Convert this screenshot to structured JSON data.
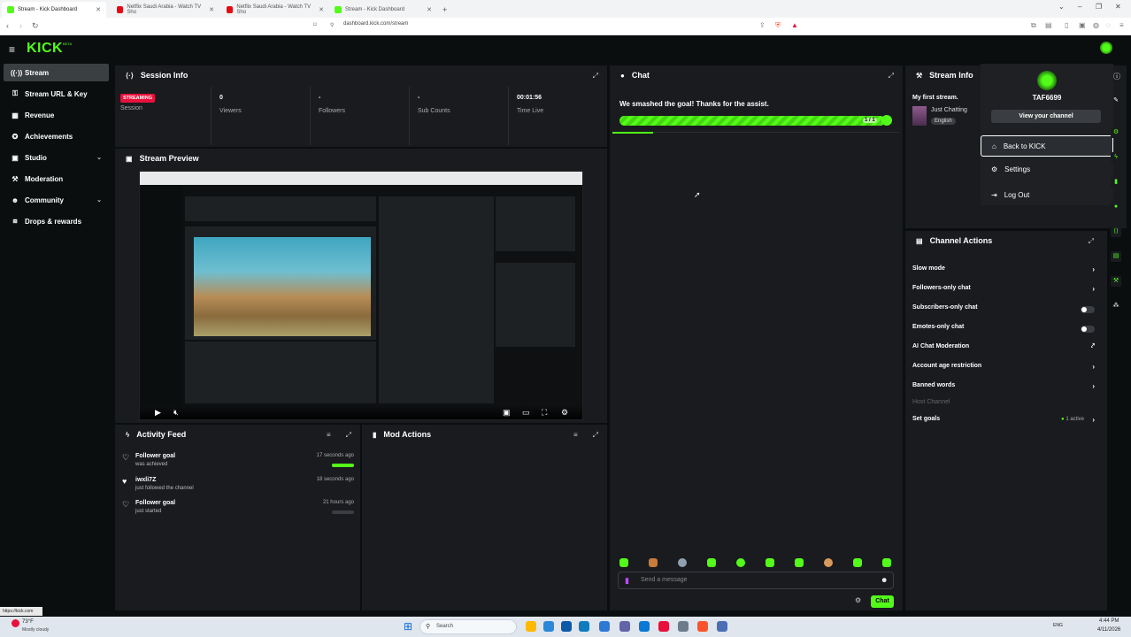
{
  "browser": {
    "tabs": [
      {
        "title": "Stream - Kick Dashboard",
        "active": true
      },
      {
        "title": "Netflix Saudi Arabia - Watch TV Sho",
        "active": false
      },
      {
        "title": "Netflix Saudi Arabia - Watch TV Sho",
        "active": false
      },
      {
        "title": "Stream - Kick Dashboard",
        "active": false
      }
    ],
    "new_tab": "+",
    "url": "dashboard.kick.com/stream"
  },
  "app": {
    "logo": "KICK",
    "logo_badge": "BETA"
  },
  "sidebar": {
    "items": [
      {
        "label": "Stream",
        "icon": "antenna-icon"
      },
      {
        "label": "Stream URL & Key",
        "icon": "key-icon"
      },
      {
        "label": "Revenue",
        "icon": "revenue-icon"
      },
      {
        "label": "Achievements",
        "icon": "trophy-icon"
      },
      {
        "label": "Studio",
        "icon": "studio-icon"
      },
      {
        "label": "Moderation",
        "icon": "wrench-icon"
      },
      {
        "label": "Community",
        "icon": "community-icon"
      },
      {
        "label": "Drops & rewards",
        "icon": "gift-icon"
      }
    ]
  },
  "session": {
    "title": "Session Info",
    "badge": "STREAMING",
    "stats": [
      {
        "value": "",
        "label": "Session"
      },
      {
        "value": "0",
        "label": "Viewers"
      },
      {
        "value": "-",
        "label": "Followers"
      },
      {
        "value": "-",
        "label": "Sub Counts"
      },
      {
        "value": "00:01:56",
        "label": "Time Live"
      }
    ]
  },
  "preview": {
    "title": "Stream Preview"
  },
  "activity": {
    "title": "Activity Feed",
    "items": [
      {
        "title": "Follower goal",
        "sub": "was achieved",
        "time": "17 seconds ago",
        "progress": 1.0
      },
      {
        "title": "iwxli7Z",
        "sub": "just followed the channel",
        "time": "18 seconds ago"
      },
      {
        "title": "Follower goal",
        "sub": "just started",
        "time": "21 hours ago",
        "progress": 0.0
      }
    ]
  },
  "mod": {
    "title": "Mod Actions"
  },
  "chat": {
    "title": "Chat",
    "goal_text": "We smashed the goal! Thanks for the assist.",
    "goal_count": "1 / 1",
    "goal_progress": 1.0,
    "input_placeholder": "Send a message",
    "send_label": "Chat"
  },
  "stream_info": {
    "title": "Stream Info",
    "stream_title": "My first stream.",
    "category": "Just Chatting",
    "language": "English"
  },
  "user_menu": {
    "username": "TAF6699",
    "view_channel": "View your channel",
    "items": [
      {
        "label": "Back to KICK",
        "icon": "home-icon"
      },
      {
        "label": "Settings",
        "icon": "gear-icon"
      },
      {
        "label": "Log Out",
        "icon": "logout-icon"
      }
    ]
  },
  "channel_actions": {
    "title": "Channel Actions",
    "items": [
      {
        "label": "Slow mode",
        "control": "chevron"
      },
      {
        "label": "Followers-only chat",
        "control": "chevron"
      },
      {
        "label": "Subscribers-only chat",
        "control": "toggle",
        "on": false
      },
      {
        "label": "Emotes-only chat",
        "control": "toggle",
        "on": false
      },
      {
        "label": "AI Chat Moderation",
        "control": "external"
      },
      {
        "label": "Account age restriction",
        "control": "chevron"
      },
      {
        "label": "Banned words",
        "control": "chevron"
      },
      {
        "label": "Host Channel",
        "control": "none",
        "disabled": true
      },
      {
        "label": "Set goals",
        "control": "chevron",
        "status": "1 active"
      }
    ]
  },
  "taskbar": {
    "status_url": "https://kick.com",
    "weather_temp": "73°F",
    "weather_desc": "Mostly cloudy",
    "search": "Search",
    "lang": "ENG",
    "time": "4:44 PM",
    "date": "4/11/2026"
  },
  "colors": {
    "accent": "#53fc18",
    "live": "#e9113c",
    "panel": "#191b1f",
    "bg": "#0b0e0f"
  }
}
